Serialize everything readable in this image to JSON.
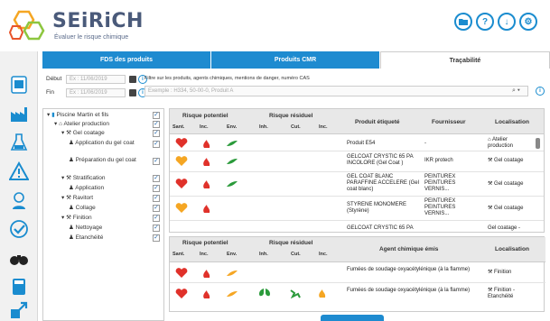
{
  "app": {
    "name": "SEiRiCH",
    "subtitle": "Évaluer le risque chimique"
  },
  "header_buttons": [
    {
      "name": "folder",
      "label": "folder"
    },
    {
      "name": "help",
      "label": "?"
    },
    {
      "name": "download",
      "label": "↓"
    },
    {
      "name": "settings",
      "label": "⚙"
    }
  ],
  "tabs": [
    {
      "label": "FDS des produits"
    },
    {
      "label": "Produits CMR"
    },
    {
      "label": "Traçabilité"
    }
  ],
  "filters": {
    "debut_label": "Début",
    "fin_label": "Fin",
    "date_placeholder_debut": "Ex : 11/06/2019",
    "date_placeholder_fin": "Ex : 11/06/2019",
    "search_hint": "Filtre sur les produits, agents chimiques, mentions de danger, numéro CAS",
    "search_placeholder": "Exemple : H334, 50-00-0, Produit A"
  },
  "tree": [
    {
      "label": "Piscine Martin et fils",
      "level": 0
    },
    {
      "label": "Atelier production",
      "level": 1
    },
    {
      "label": "Gel coatage",
      "level": 2
    },
    {
      "label": "Application du gel coat",
      "level": 3
    },
    {
      "label": "Préparation du gel coat",
      "level": 3
    },
    {
      "label": "Stratification",
      "level": 2
    },
    {
      "label": "Application",
      "level": 3
    },
    {
      "label": "Ravitort",
      "level": 2
    },
    {
      "label": "Collage",
      "level": 3
    },
    {
      "label": "Finition",
      "level": 2
    },
    {
      "label": "Nettoyage",
      "level": 3
    },
    {
      "label": "Etanchéité",
      "level": 3
    }
  ],
  "products_table": {
    "group_headers": [
      "Risque potentiel",
      "Risque résiduel"
    ],
    "sub_headers": [
      "Sant.",
      "Inc.",
      "Env.",
      "Inh.",
      "Cut.",
      "Inc."
    ],
    "col_headers": [
      "Produit étiqueté",
      "Fournisseur",
      "Localisation"
    ],
    "rows": [
      {
        "product": "Produit E54",
        "supplier": "-",
        "location": "Atelier production",
        "heart": "red"
      },
      {
        "product": "GELCOAT CRYSTIC 65 PA INCOLORE (Gel Coat )",
        "supplier": "IKR protech",
        "location": "Gel coatage",
        "heart": "orange"
      },
      {
        "product": "GEL COAT BLANC PARAFFINE ACCELERE (Gel coat blanc)",
        "supplier": "PEINTUREX PEINTURES VERNIS...",
        "location": "Gel coatage",
        "heart": "red"
      },
      {
        "product": "STYRENE MONOMERE (Styrène)",
        "supplier": "PEINTUREX PEINTURES VERNIS...",
        "location": "Gel coatage",
        "heart": "orange"
      },
      {
        "product": "GELCOAT CRYSTIC 65 PA",
        "supplier": "",
        "location": "Gel coatage -",
        "heart": "red"
      }
    ]
  },
  "agents_table": {
    "group_headers": [
      "Risque potentiel",
      "Risque résiduel"
    ],
    "sub_headers": [
      "Sant.",
      "Inc.",
      "Env.",
      "Inh.",
      "Cut.",
      "Inc."
    ],
    "col_headers": [
      "Agent chimique émis",
      "Localisation"
    ],
    "rows": [
      {
        "agent": "Fumées de soudage oxyacétylénique (à la flamme)",
        "location": "Finition"
      },
      {
        "agent": "Fumées de soudage oxyacétylénique (à la flamme)",
        "location": "Finition - Etanchéité"
      }
    ]
  },
  "colors": {
    "accent": "#1e8bd0",
    "danger": "#e0312a",
    "warning": "#f5a623",
    "eco": "#2a9a3a"
  }
}
